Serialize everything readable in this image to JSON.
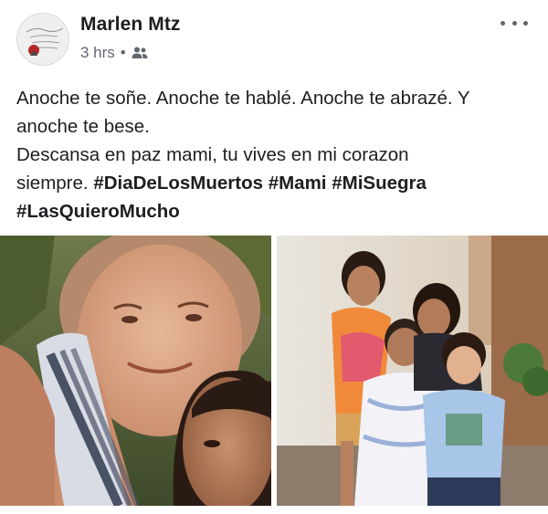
{
  "post": {
    "author_name": "Marlen Mtz",
    "time_ago": "3 hrs",
    "separator": "•",
    "audience_icon": "friends-icon",
    "more_icon": "more-options-icon",
    "text_lines": [
      {
        "plain": "Anoche te soñe. Anoche te hablé. Anoche te abrazé. Y"
      },
      {
        "plain": "anoche te bese."
      },
      {
        "plain": "Descansa en paz mami, tu vives en mi corazon"
      },
      {
        "plain": "siempre. ",
        "tags": [
          "#DiaDeLosMuertos",
          "#Mami",
          "#MiSuegra"
        ]
      },
      {
        "tags": [
          "#LasQuieroMucho"
        ]
      }
    ]
  },
  "photos": [
    {
      "name": "photo-selfie-two-women"
    },
    {
      "name": "photo-family-group"
    }
  ],
  "colors": {
    "text": "#1c1e21",
    "meta": "#606770"
  }
}
